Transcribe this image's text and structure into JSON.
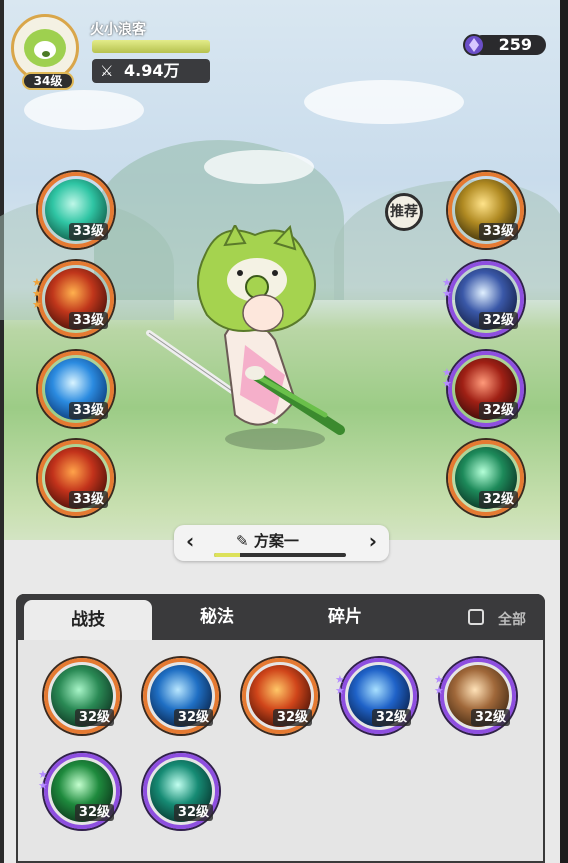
{
  "player": {
    "name": "火小浪客",
    "level": "34级",
    "power": "4.94万",
    "xp_fraction": 1.0
  },
  "currency": {
    "icon": "purple-gem-icon",
    "amount": "259"
  },
  "recommend_label": "推荐",
  "left_skills": [
    {
      "name": "wind-vortex",
      "level": "33级",
      "frame": "orange",
      "stars": 0,
      "colors": [
        "#0c4f3d",
        "#2fc5a4",
        "#bff7e8"
      ]
    },
    {
      "name": "fire-phoenix",
      "level": "33级",
      "frame": "orange",
      "stars": 3,
      "colors": [
        "#3a0b07",
        "#c0361b",
        "#ffb14e"
      ]
    },
    {
      "name": "ice-shatter",
      "level": "33级",
      "frame": "orange",
      "stars": 0,
      "colors": [
        "#082f6a",
        "#2b8be0",
        "#d9f4ff"
      ]
    },
    {
      "name": "flame-burst",
      "level": "33级",
      "frame": "orange",
      "stars": 0,
      "colors": [
        "#3b0c06",
        "#c2321b",
        "#ffa34a"
      ]
    }
  ],
  "right_skills": [
    {
      "name": "golden-strike",
      "level": "33级",
      "frame": "orange",
      "stars": 0,
      "colors": [
        "#2e2508",
        "#b08a22",
        "#ffe38a"
      ]
    },
    {
      "name": "spirit-star",
      "level": "32级",
      "frame": "purple",
      "stars": 2,
      "colors": [
        "#10183a",
        "#3a58a8",
        "#e0f0ff"
      ]
    },
    {
      "name": "blood-orb",
      "level": "32级",
      "frame": "purple",
      "stars": 2,
      "colors": [
        "#2a0808",
        "#a02015",
        "#ff9a7a"
      ]
    },
    {
      "name": "emerald-shield",
      "level": "32级",
      "frame": "orange",
      "stars": 0,
      "colors": [
        "#08261c",
        "#1d8a5a",
        "#b4ffd8"
      ]
    }
  ],
  "plan": {
    "prev": "‹",
    "next": "›",
    "edit_icon": "pencil-icon",
    "title": "方案一",
    "progress": 0.2
  },
  "tabs": [
    {
      "label": "战技",
      "active": true
    },
    {
      "label": "秘法",
      "active": false
    },
    {
      "label": "碎片",
      "active": false
    }
  ],
  "select_all_label": "全部",
  "grid_skills": [
    {
      "name": "thorn-vine",
      "level": "32级",
      "frame": "orange",
      "stars": 0,
      "colors": [
        "#0b2a1c",
        "#2a8a55",
        "#a8f5c8"
      ]
    },
    {
      "name": "frost-shards",
      "level": "32级",
      "frame": "orange",
      "stars": 0,
      "colors": [
        "#071b3c",
        "#1f6fc4",
        "#b9e7ff"
      ]
    },
    {
      "name": "fire-orb",
      "level": "32级",
      "frame": "orange",
      "stars": 0,
      "colors": [
        "#3b0d05",
        "#d0451a",
        "#ffc768"
      ]
    },
    {
      "name": "water-wave",
      "level": "32级",
      "frame": "purple",
      "stars": 2,
      "colors": [
        "#071a3e",
        "#1f62c8",
        "#a8e0ff"
      ]
    },
    {
      "name": "stone-slab",
      "level": "32级",
      "frame": "purple",
      "stars": 2,
      "colors": [
        "#3a2410",
        "#a0683a",
        "#ffe2b8"
      ]
    },
    {
      "name": "healing-cross",
      "level": "32级",
      "frame": "purple",
      "stars": 2,
      "colors": [
        "#0a2a16",
        "#1e8a3d",
        "#c4ffcf"
      ]
    },
    {
      "name": "wind-slash",
      "level": "32级",
      "frame": "purple",
      "stars": 0,
      "colors": [
        "#062a25",
        "#168b74",
        "#c2fff0"
      ]
    }
  ]
}
